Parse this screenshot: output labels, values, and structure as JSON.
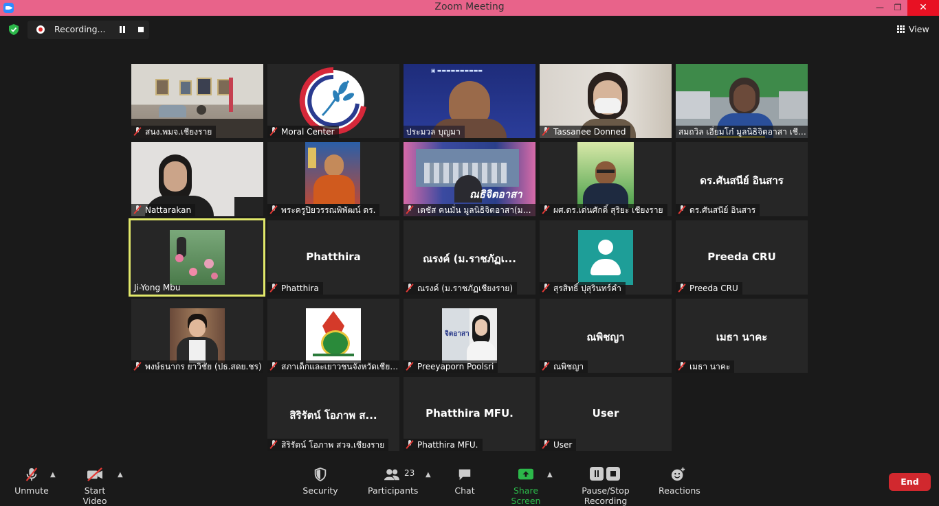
{
  "window": {
    "title": "Zoom Meeting",
    "minimize": "—",
    "maximize": "❐",
    "close": "✕"
  },
  "recording": {
    "label": "Recording..."
  },
  "view": {
    "label": "View"
  },
  "participants_grid": [
    {
      "name": "สนง.พมจ.เชียงราย",
      "display": "",
      "video": "office"
    },
    {
      "name": "Moral Center",
      "display": "",
      "video": "logo-moral"
    },
    {
      "name": "ประมวล บุญมา",
      "display": "",
      "video": "man-blue"
    },
    {
      "name": "Tassanee Donned",
      "display": "",
      "video": "woman-mask"
    },
    {
      "name": "สมถวิล เอี่ยมโก๋ มูลนิธิจิตอาสา เชียง...",
      "display": "",
      "video": "woman-office"
    },
    {
      "name": "Nattarakan",
      "display": "",
      "video": "woman-white"
    },
    {
      "name": "พระครูปิยวรรณพิพัฒน์ ดร.",
      "display": "",
      "video": "monk"
    },
    {
      "name": "เตชัส คนมั่น มูลนิธิจิตอาสา(มนส.)",
      "display": "",
      "video": "banner"
    },
    {
      "name": "ผศ.ดร.เด่นศักดิ์ สุริยะ เชียงราย",
      "display": "",
      "video": "man-glasses"
    },
    {
      "name": "ดร.ศันสนีย์ อินสาร",
      "display": "ดร.ศันสนีย์ อินสาร",
      "video": ""
    },
    {
      "name": "Ji-Yong Mbu",
      "display": "",
      "video": "flower"
    },
    {
      "name": "Phatthira",
      "display": "Phatthira",
      "video": ""
    },
    {
      "name": "ณรงค์ (ม.ราชภัฏเชียงราย)",
      "display": "ณรงค์ (ม.ราชภัฏเ...",
      "video": ""
    },
    {
      "name": "สุรสิทธิ์ ปุสุรินทร์คำ",
      "display": "",
      "video": "avatar"
    },
    {
      "name": "Preeda CRU",
      "display": "Preeda CRU",
      "video": ""
    },
    {
      "name": "พงษ์ธนากร ยาวิชัย (ปธ.สดย.ชร)",
      "display": "",
      "video": "young-man"
    },
    {
      "name": "สภาเด็กและเยาวชนจังหวัดเชียงร...",
      "display": "",
      "video": "emblem"
    },
    {
      "name": "Preeyaporn Poolsri",
      "display": "",
      "video": "woman-sign"
    },
    {
      "name": "ณพิชญา",
      "display": "ณพิชญา",
      "video": ""
    },
    {
      "name": "เมธา นาคะ",
      "display": "เมธา นาคะ",
      "video": ""
    },
    {
      "name": "สิริรัตน์ โอภาพ สวจ.เชียงราย",
      "display": "สิริรัตน์ โอภาพ ส...",
      "video": ""
    },
    {
      "name": "Phatthira MFU.",
      "display": "Phatthira MFU.",
      "video": ""
    },
    {
      "name": "User",
      "display": "User",
      "video": ""
    }
  ],
  "speaker_index": 10,
  "overlays": {
    "banner_text": "ณธิจิตอาสา"
  },
  "toolbar": {
    "unmute": "Unmute",
    "start_video": "Start Video",
    "security": "Security",
    "participants": "Participants",
    "participants_count": "23",
    "chat": "Chat",
    "share_screen": "Share Screen",
    "pause_stop_recording": "Pause/Stop Recording",
    "reactions": "Reactions",
    "end": "End"
  },
  "colors": {
    "titlebar": "#e8638a",
    "speaker_border": "#e1e86a",
    "share_green": "#2cb84a",
    "end_red": "#d1282e",
    "avatar_teal": "#1e9e98"
  }
}
